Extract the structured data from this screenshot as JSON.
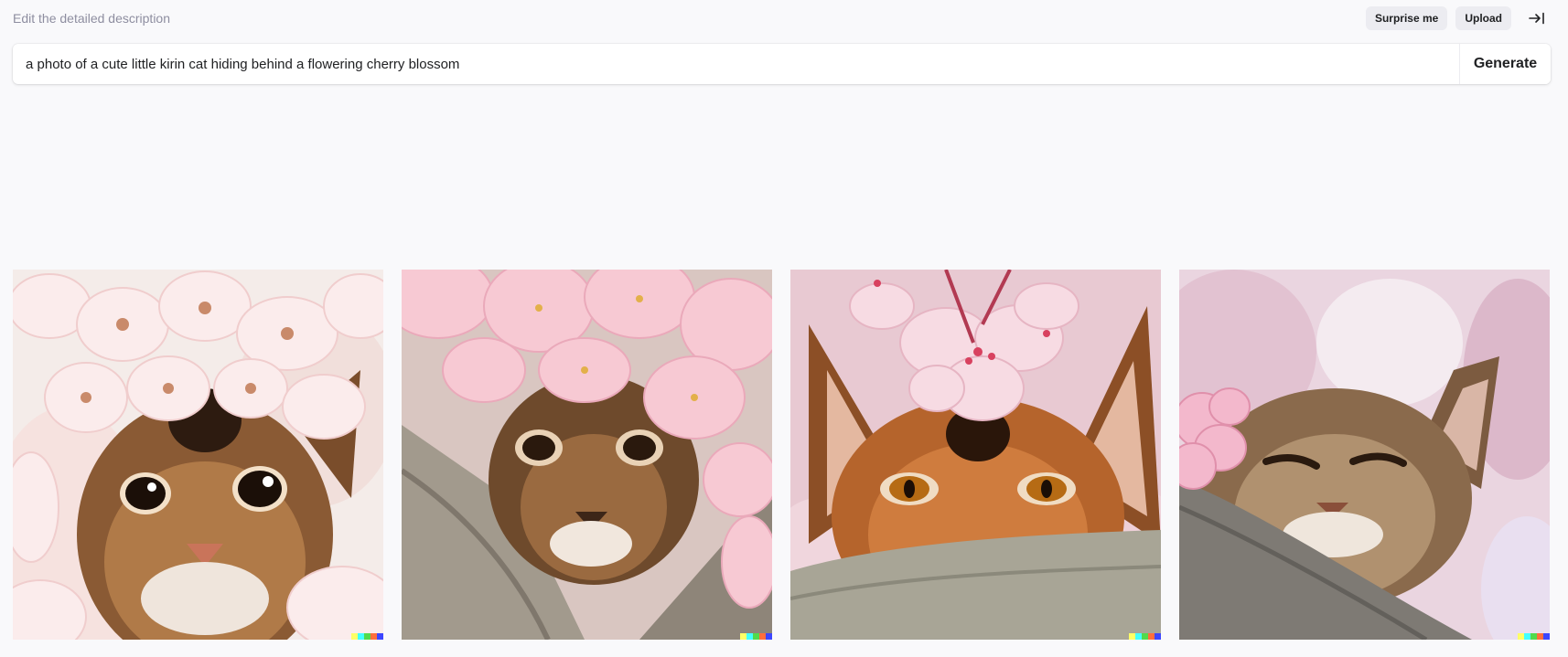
{
  "header": {
    "label": "Edit the detailed description",
    "surprise_label": "Surprise me",
    "upload_label": "Upload",
    "collapse_icon": "collapse-right-icon"
  },
  "prompt": {
    "value": "a photo of a cute little kirin cat hiding behind a flowering cherry blossom",
    "generate_label": "Generate"
  },
  "gallery": {
    "images": [
      {
        "alt": "Kitten face surrounded by pale pink cherry blossoms"
      },
      {
        "alt": "Cat peeking from behind a tree branch under pink blossoms"
      },
      {
        "alt": "Orange cat with large ears behind a branch with a blossom on its head"
      },
      {
        "alt": "Cat resting behind a branch with soft pink blossom background"
      }
    ],
    "signature_colors": [
      "#ffff66",
      "#42ffff",
      "#51da4c",
      "#ff6e3c",
      "#3c46ff"
    ]
  }
}
